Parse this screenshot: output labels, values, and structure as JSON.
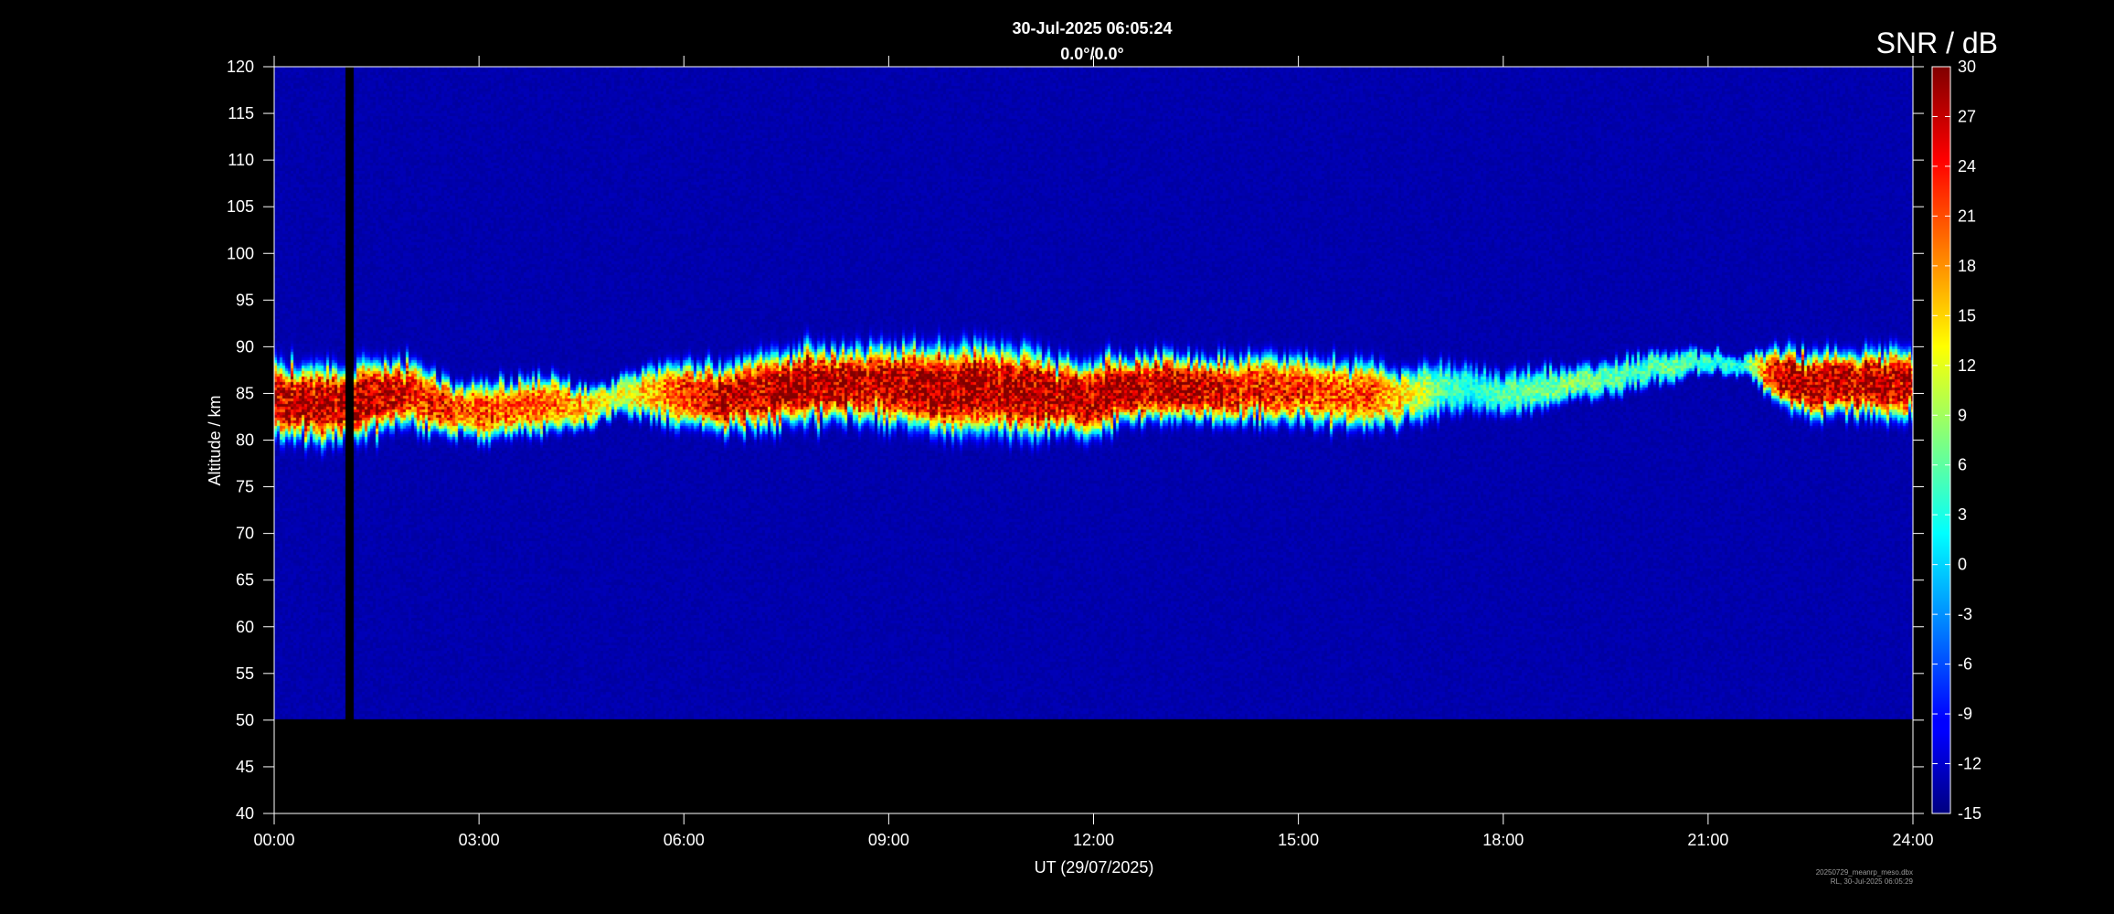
{
  "title": {
    "line1": "30-Jul-2025 06:05:24",
    "line2": "0.0°/0.0°"
  },
  "chart_data": {
    "type": "heatmap",
    "xlabel": "UT (29/07/2025)",
    "ylabel": "Altitude / km",
    "x_ticks": [
      "00:00",
      "03:00",
      "06:00",
      "09:00",
      "12:00",
      "15:00",
      "18:00",
      "21:00",
      "24:00"
    ],
    "y_ticks": [
      40,
      45,
      50,
      55,
      60,
      65,
      70,
      75,
      80,
      85,
      90,
      95,
      100,
      105,
      110,
      115,
      120
    ],
    "xlim_hours": [
      0,
      24
    ],
    "ylim_km": [
      40,
      120
    ],
    "data_altitude_range_km": [
      50,
      120
    ],
    "background_snr_db": -13,
    "colorbar": {
      "label": "SNR / dB",
      "ticks": [
        -15,
        -12,
        -9,
        -6,
        -3,
        0,
        3,
        6,
        9,
        12,
        15,
        18,
        21,
        24,
        27,
        30
      ],
      "range": [
        -15,
        30
      ],
      "colormap": "jet"
    },
    "data_gap_hours": [
      1.05,
      1.15
    ],
    "echo_layer": {
      "profile_hours": [
        0.0,
        0.5,
        1.0,
        1.5,
        2.0,
        2.5,
        3.0,
        3.5,
        4.0,
        4.5,
        5.0,
        5.5,
        6.0,
        6.5,
        7.0,
        7.5,
        8.0,
        8.5,
        9.0,
        9.5,
        10.0,
        10.5,
        11.0,
        11.5,
        12.0,
        12.5,
        13.0,
        13.5,
        14.0,
        14.5,
        15.0,
        15.5,
        16.0,
        16.5,
        17.0,
        17.5,
        18.0,
        18.5,
        19.0,
        19.5,
        20.0,
        20.5,
        21.0,
        21.5,
        22.0,
        22.5,
        23.0,
        23.5,
        24.0
      ],
      "center_km": [
        84.5,
        84.0,
        84.0,
        84.5,
        85.0,
        83.5,
        83.0,
        83.5,
        84.0,
        83.5,
        84.5,
        85.0,
        85.0,
        84.5,
        85.0,
        85.5,
        86.0,
        86.0,
        86.0,
        85.5,
        85.5,
        85.5,
        85.0,
        84.5,
        84.5,
        85.5,
        85.5,
        85.5,
        85.5,
        85.5,
        85.5,
        85.0,
        84.5,
        84.5,
        85.5,
        85.5,
        85.0,
        85.5,
        86.0,
        86.5,
        87.5,
        88.0,
        88.5,
        88.0,
        87.0,
        86.0,
        86.0,
        86.0,
        86.0
      ],
      "half_width_km": [
        3.5,
        3.5,
        3.5,
        3.5,
        3.0,
        2.5,
        2.5,
        2.5,
        2.5,
        2.0,
        1.5,
        2.5,
        3.0,
        3.0,
        3.5,
        3.5,
        3.5,
        3.5,
        3.5,
        4.0,
        4.0,
        4.0,
        4.0,
        3.5,
        3.5,
        3.0,
        3.0,
        3.0,
        3.0,
        3.0,
        3.0,
        3.0,
        3.0,
        2.5,
        2.5,
        2.0,
        2.0,
        2.0,
        1.5,
        1.5,
        1.5,
        1.5,
        1.0,
        0.8,
        2.5,
        3.0,
        3.0,
        3.0,
        3.0
      ],
      "peak_snr_db": [
        29,
        29,
        29,
        29,
        26,
        24,
        22,
        22,
        21,
        18,
        12,
        17,
        24,
        28,
        29,
        30,
        30,
        29,
        29,
        30,
        30,
        30,
        30,
        30,
        30,
        29,
        29,
        29,
        27,
        25,
        24,
        23,
        23,
        16,
        8,
        3,
        6,
        8,
        8,
        7,
        6,
        7,
        5,
        3,
        29,
        30,
        30,
        29,
        29
      ]
    }
  },
  "footer": {
    "line1": "20250729_meanrp_meso.dbx",
    "line2": "RL, 30-Jul-2025 06:05:29"
  }
}
